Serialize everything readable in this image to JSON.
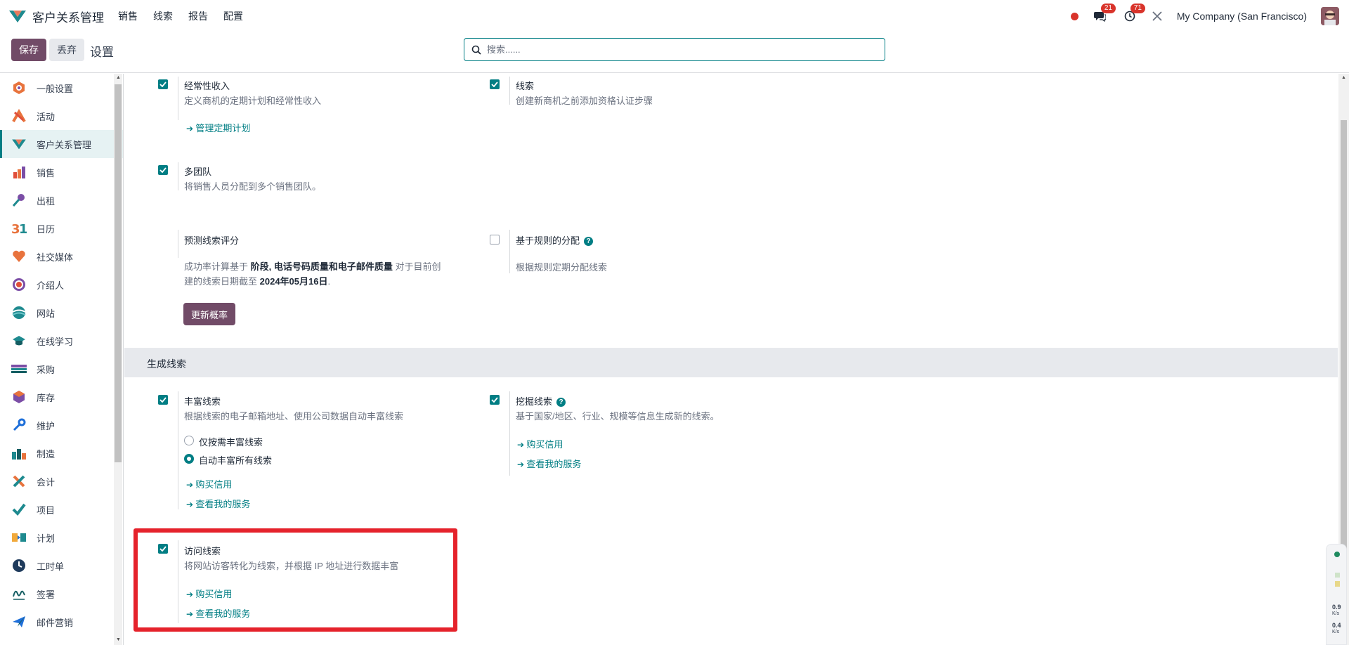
{
  "navbar": {
    "brand": "客户关系管理",
    "menu": [
      "销售",
      "线索",
      "报告",
      "配置"
    ],
    "chat_count": "21",
    "activity_count": "71",
    "company": "My Company (San Francisco)"
  },
  "control_panel": {
    "save_label": "保存",
    "discard_label": "丢弃",
    "title": "设置",
    "search_placeholder": "搜索......"
  },
  "sidebar": {
    "items": [
      {
        "label": "一般设置",
        "icon": "settings-icon"
      },
      {
        "label": "活动",
        "icon": "activity-icon"
      },
      {
        "label": "客户关系管理",
        "icon": "crm-icon",
        "active": true
      },
      {
        "label": "销售",
        "icon": "sales-icon"
      },
      {
        "label": "出租",
        "icon": "rental-icon"
      },
      {
        "label": "日历",
        "icon": "calendar-icon"
      },
      {
        "label": "社交媒体",
        "icon": "social-icon"
      },
      {
        "label": "介绍人",
        "icon": "referral-icon"
      },
      {
        "label": "网站",
        "icon": "website-icon"
      },
      {
        "label": "在线学习",
        "icon": "elearning-icon"
      },
      {
        "label": "采购",
        "icon": "purchase-icon"
      },
      {
        "label": "库存",
        "icon": "inventory-icon"
      },
      {
        "label": "维护",
        "icon": "maintenance-icon"
      },
      {
        "label": "制造",
        "icon": "manufacturing-icon"
      },
      {
        "label": "会计",
        "icon": "accounting-icon"
      },
      {
        "label": "项目",
        "icon": "project-icon"
      },
      {
        "label": "计划",
        "icon": "planning-icon"
      },
      {
        "label": "工时单",
        "icon": "timesheet-icon"
      },
      {
        "label": "签署",
        "icon": "sign-icon"
      },
      {
        "label": "邮件营销",
        "icon": "email-marketing-icon"
      }
    ]
  },
  "settings": {
    "recurring": {
      "title": "经常性收入",
      "desc": "定义商机的定期计划和经常性收入",
      "link": "管理定期计划",
      "checked": true
    },
    "leads": {
      "title": "线索",
      "desc": "创建新商机之前添加资格认证步骤",
      "checked": true
    },
    "multi_team": {
      "title": "多团队",
      "desc": "将销售人员分配到多个销售团队。",
      "checked": true
    },
    "predictive": {
      "title": "预测线索评分",
      "desc_a": "成功率计算基于 ",
      "desc_b": "阶段, 电话号码质量和电子邮件质量",
      "desc_c": " 对于目前创",
      "desc_d": "建的线索日期截至 ",
      "desc_e": "2024年05月16日",
      "desc_f": ".",
      "button": "更新概率"
    },
    "rule_based": {
      "title": "基于规则的分配",
      "desc": "根据规则定期分配线索",
      "checked": false
    },
    "section_title": "生成线索",
    "enrich": {
      "title": "丰富线索",
      "desc": "根据线索的电子邮箱地址、使用公司数据自动丰富线索",
      "radio_on_demand": "仅按需丰富线索",
      "radio_auto": "自动丰富所有线索",
      "link_buy": "购买信用",
      "link_services": "查看我的服务",
      "checked": true
    },
    "mine": {
      "title": "挖掘线索",
      "desc": "基于国家/地区、行业、规模等信息生成新的线索。",
      "link_buy": "购买信用",
      "link_services": "查看我的服务",
      "checked": true
    },
    "visits": {
      "title": "访问线索",
      "desc": "将网站访客转化为线索，并根据 IP 地址进行数据丰富",
      "link_buy": "购买信用",
      "link_services": "查看我的服务",
      "checked": true
    }
  },
  "net_meter": {
    "up": "0.9",
    "up_unit": "K/s",
    "down": "0.4",
    "down_unit": "K/s"
  },
  "colors": {
    "primary": "#714b67",
    "accent": "#017e84",
    "highlight": "#e5222b"
  }
}
